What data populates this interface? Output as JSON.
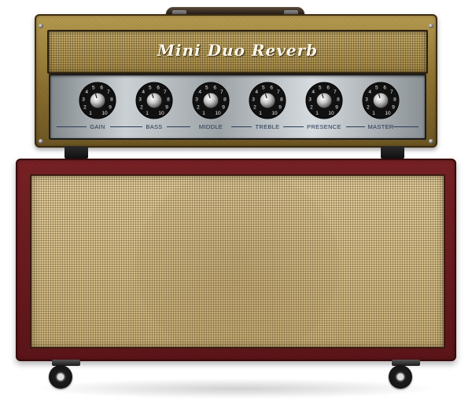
{
  "amp": {
    "name": "Mini Duo Reverb",
    "colors": {
      "tolex_head": "#8a6d2c",
      "tolex_cabinet": "#6b1b1f",
      "grille_cloth": "#d6c08a",
      "label_text": "#1f3350"
    },
    "knobs": [
      {
        "label": "GAIN",
        "value": 5,
        "scale": [
          "1",
          "2",
          "3",
          "4",
          "5",
          "6",
          "7",
          "8",
          "9",
          "10"
        ]
      },
      {
        "label": "BASS",
        "value": 5,
        "scale": [
          "1",
          "2",
          "3",
          "4",
          "5",
          "6",
          "7",
          "8",
          "9",
          "10"
        ]
      },
      {
        "label": "MIDDLE",
        "value": 5,
        "scale": [
          "1",
          "2",
          "3",
          "4",
          "5",
          "6",
          "7",
          "8",
          "9",
          "10"
        ]
      },
      {
        "label": "TREBLE",
        "value": 5,
        "scale": [
          "1",
          "2",
          "3",
          "4",
          "5",
          "6",
          "7",
          "8",
          "9",
          "10"
        ]
      },
      {
        "label": "PRESENCE",
        "value": 5,
        "scale": [
          "1",
          "2",
          "3",
          "4",
          "5",
          "6",
          "7",
          "8",
          "9",
          "10"
        ]
      },
      {
        "label": "MASTER",
        "value": 5,
        "scale": [
          "1",
          "2",
          "3",
          "4",
          "5",
          "6",
          "7",
          "8",
          "9",
          "10"
        ]
      }
    ]
  }
}
